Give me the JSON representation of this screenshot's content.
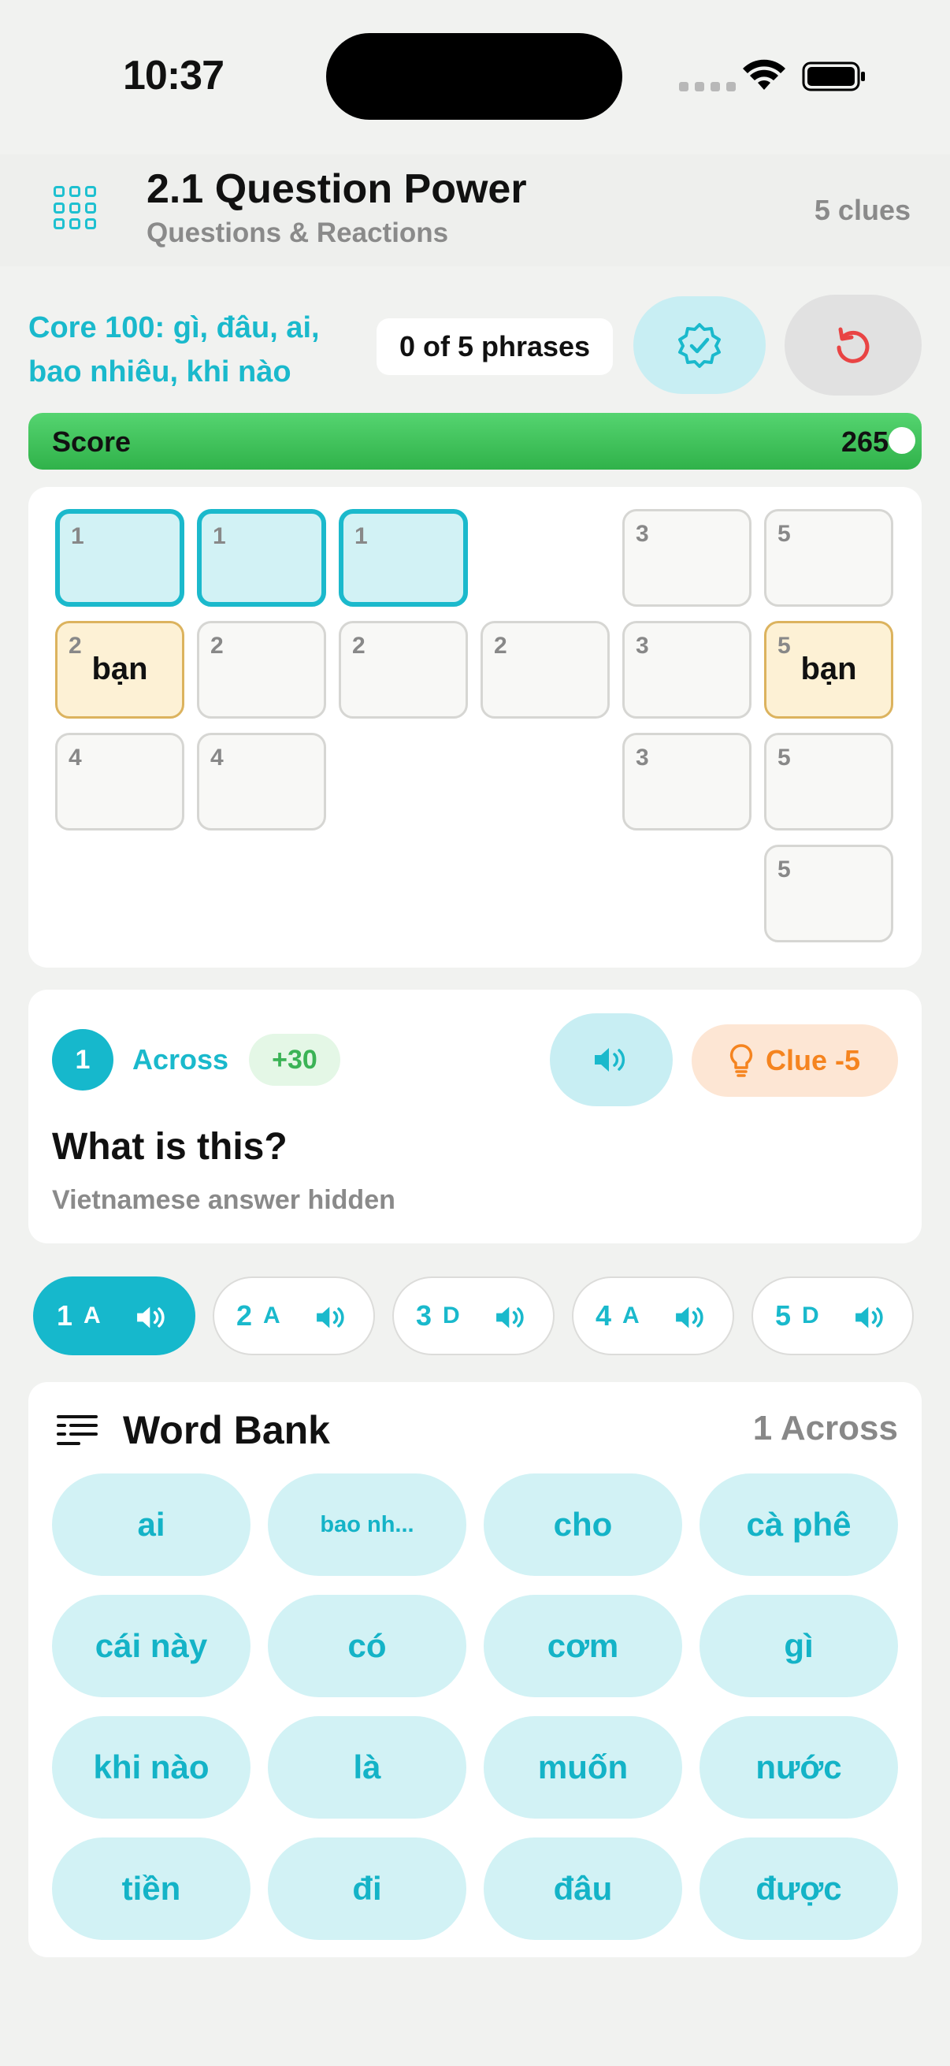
{
  "status": {
    "time": "10:37"
  },
  "header": {
    "title": "2.1 Question Power",
    "subtitle": "Questions & Reactions",
    "clues": "5 clues"
  },
  "toolbar": {
    "core_text": "Core 100: gì, đâu, ai, bao nhiêu, khi nào",
    "phrases": "0 of 5 phrases"
  },
  "score": {
    "label": "Score",
    "value": "265",
    "fill_fraction": 1.0
  },
  "grid": {
    "cells": [
      {
        "num": "1",
        "letter": "",
        "state": "active"
      },
      {
        "num": "1",
        "letter": "",
        "state": "active"
      },
      {
        "num": "1",
        "letter": "",
        "state": "active"
      },
      {
        "num": "3",
        "letter": "",
        "state": "empty"
      },
      {
        "num": "5",
        "letter": "",
        "state": "empty"
      },
      {
        "num": "2",
        "letter": "bạn",
        "state": "filled"
      },
      {
        "num": "2",
        "letter": "",
        "state": "empty"
      },
      {
        "num": "2",
        "letter": "",
        "state": "empty"
      },
      {
        "num": "2",
        "letter": "",
        "state": "empty"
      },
      {
        "num": "3",
        "letter": "",
        "state": "empty"
      },
      {
        "num": "5",
        "letter": "bạn",
        "state": "filled"
      },
      {
        "num": "4",
        "letter": "",
        "state": "empty"
      },
      {
        "num": "4",
        "letter": "",
        "state": "empty"
      },
      {
        "num": "3",
        "letter": "",
        "state": "empty"
      },
      {
        "num": "5",
        "letter": "",
        "state": "empty"
      },
      {
        "num": "5",
        "letter": "",
        "state": "empty"
      }
    ]
  },
  "clue": {
    "number": "1",
    "direction": "Across",
    "points": "+30",
    "hint_button": "Clue -5",
    "question": "What is this?",
    "answer_hint": "Vietnamese answer hidden"
  },
  "tabs": [
    {
      "num": "1",
      "dir": "A",
      "active": true
    },
    {
      "num": "2",
      "dir": "A",
      "active": false
    },
    {
      "num": "3",
      "dir": "D",
      "active": false
    },
    {
      "num": "4",
      "dir": "A",
      "active": false
    },
    {
      "num": "5",
      "dir": "D",
      "active": false
    }
  ],
  "word_bank": {
    "title": "Word Bank",
    "target": "1 Across",
    "words": [
      "ai",
      "bao nh...",
      "cho",
      "cà phê",
      "cái này",
      "có",
      "cơm",
      "gì",
      "khi nào",
      "là",
      "muốn",
      "nước",
      "tiền",
      "đi",
      "đâu",
      "được"
    ]
  },
  "colors": {
    "accent": "#16b8cc",
    "score_green": "#3fc45a",
    "clue_orange": "#f5841f",
    "reset_red": "#e94444"
  },
  "icons": [
    "grid-menu-icon",
    "check-badge-icon",
    "reset-icon",
    "speaker-icon",
    "lightbulb-icon",
    "list-icon",
    "wifi-icon",
    "battery-icon"
  ]
}
